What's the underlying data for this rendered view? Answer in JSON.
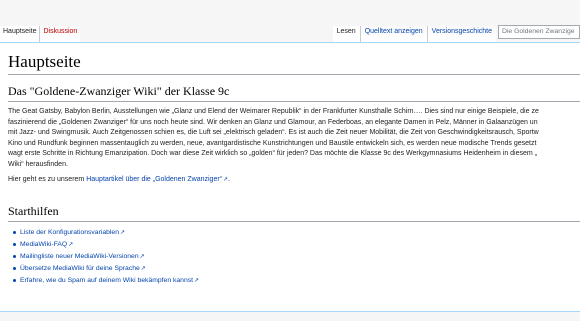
{
  "tabs": {
    "left": [
      {
        "label": "Hauptseite",
        "selected": true
      },
      {
        "label": "Diskussion",
        "red": true
      }
    ],
    "right": [
      {
        "label": "Lesen",
        "selected": true
      },
      {
        "label": "Quelltext anzeigen"
      },
      {
        "label": "Versionsgeschichte"
      }
    ]
  },
  "search": {
    "placeholder": "Die Goldenen Zwanzige"
  },
  "page": {
    "title": "Hauptseite",
    "section1_heading": "Das \"Goldene-Zwanziger Wiki\" der Klasse 9c",
    "paragraph_lines": [
      "The Geat Gatsby, Babylon Berlin, Ausstellungen wie „Glanz und Elend der Weimarer Republik“ in der Frankfurter Kunsthalle Schirn…. Dies sind nur einige Beispiele, die ze",
      "faszinierend die „Goldenen Zwanziger“ für uns noch heute sind. Wir denken an Glanz und Glamour, an Federboas, an elegante Damen in Pelz, Männer in Galaanzügen un",
      "mit Jazz- und Swingmusik. Auch Zeitgenossen schien es, die Luft sei „elektrisch geladen“. Es ist auch die Zeit neuer Mobilität, die Zeit von Geschwindigkeitsrausch, Sportw",
      "Kino und Rundfunk beginnen massentauglich zu werden, neue, avantgardistische Kunstrichtungen und Baustile entwickeln sich, es werden neue modische Trends gesetzt",
      "wagt erste Schritte in Richtung Emanzipation. Doch war diese Zeit wirklich so „golden“ für jeden? Das möchte die Klasse 9c des Werkgymnasiums Heidenheim in diesem „",
      "Wiki“ herausfinden."
    ],
    "here_prefix": "Hier geht es zu unserem ",
    "here_link": "Hauptartikel über die „Goldenen Zwanziger“",
    "here_suffix": ".",
    "section2_heading": "Starthilfen",
    "links": [
      "Liste der Konfigurationsvariablen",
      "MediaWiki-FAQ",
      "Mailingliste neuer MediaWiki-Versionen",
      "Übersetze MediaWiki für deine Sprache",
      "Erfahre, wie du Spam auf deinem Wiki bekämpfen kannst"
    ]
  }
}
